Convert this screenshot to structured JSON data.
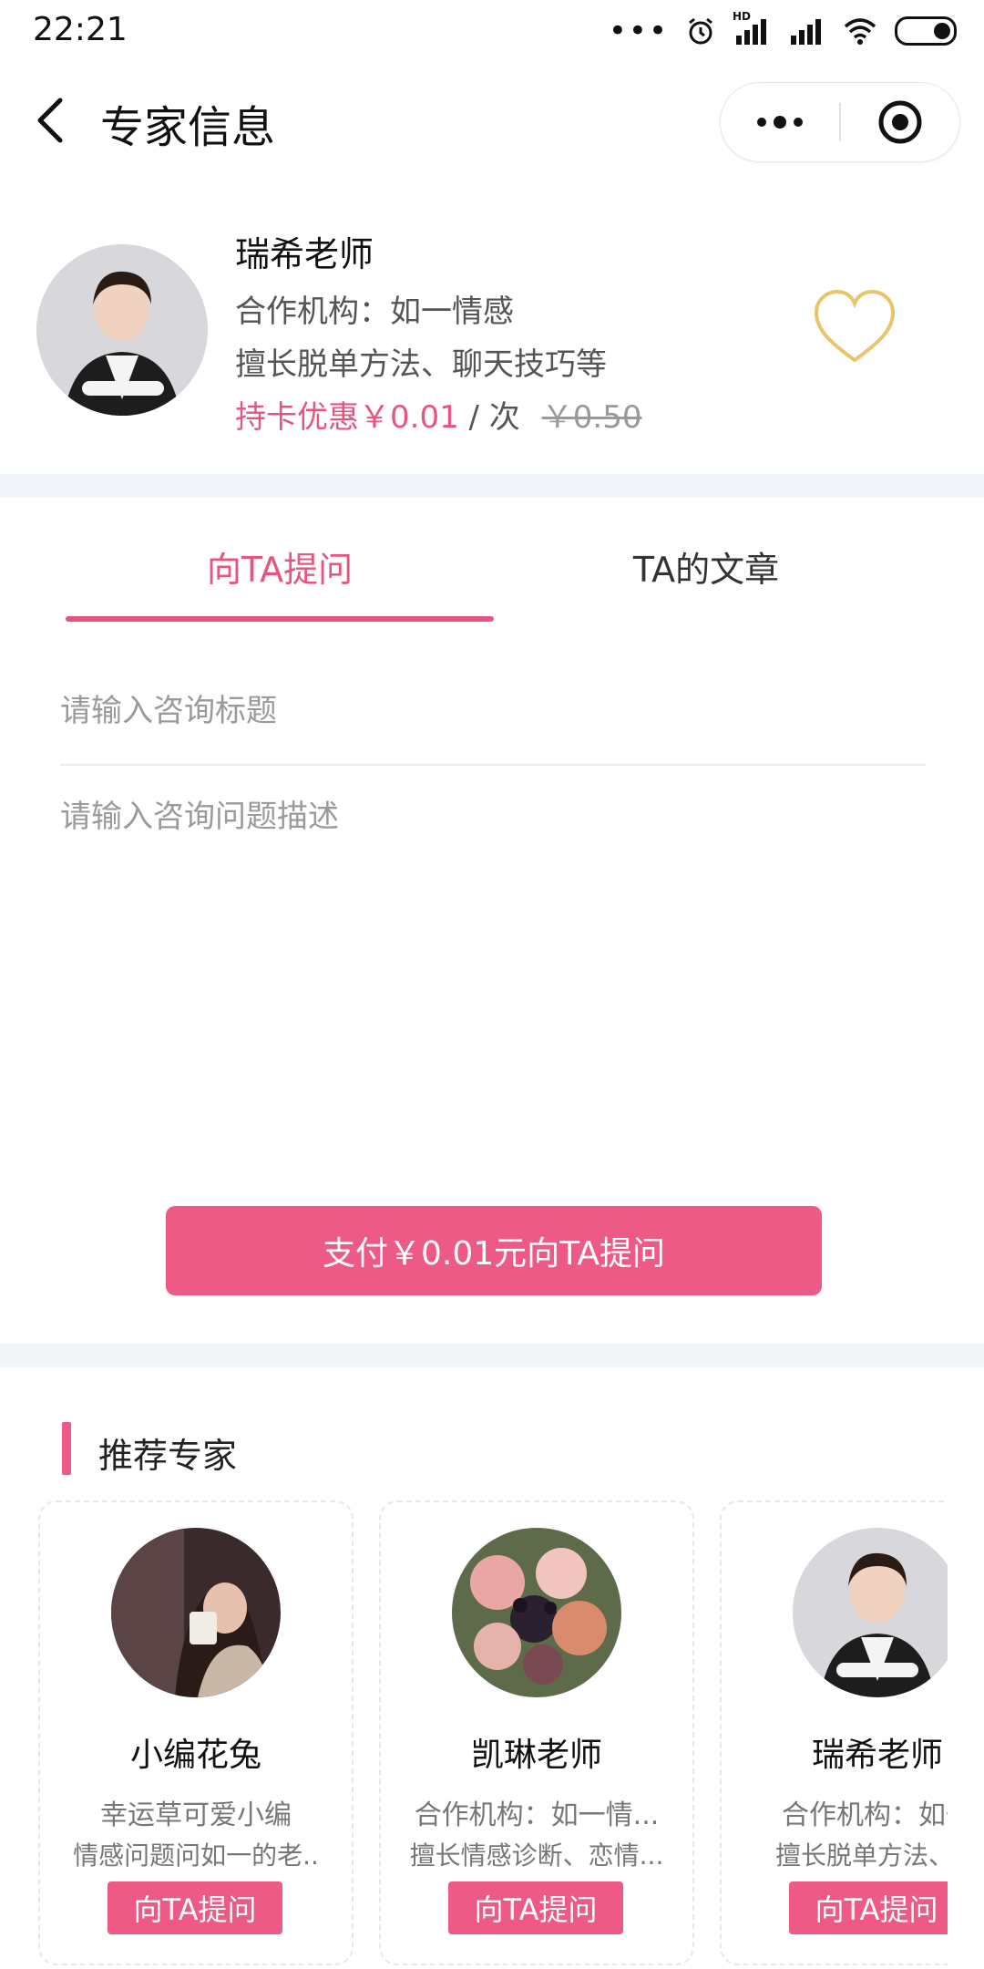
{
  "status_bar": {
    "time": "22:21",
    "hd_label": "HD"
  },
  "nav": {
    "title": "专家信息"
  },
  "expert": {
    "name": "瑞希老师",
    "org": "合作机构：如一情感",
    "skills": "擅长脱单方法、聊天技巧等",
    "price_label": "持卡优惠￥0.01",
    "price_unit": " / 次",
    "original_price": "￥0.50"
  },
  "tabs": [
    {
      "label": "向TA提问",
      "active": true
    },
    {
      "label": "TA的文章",
      "active": false
    }
  ],
  "form": {
    "title_placeholder": "请输入咨询标题",
    "desc_placeholder": "请输入咨询问题描述",
    "pay_button": "支付￥0.01元向TA提问"
  },
  "recommended": {
    "heading": "推荐专家",
    "experts": [
      {
        "name": "小编花兔",
        "line1": "幸运草可爱小编",
        "line2": "情感问题问如一的老..",
        "button": "向TA提问"
      },
      {
        "name": "凯琳老师",
        "line1": "合作机构：如一情...",
        "line2": "擅长情感诊断、恋情...",
        "button": "向TA提问"
      },
      {
        "name": "瑞希老师",
        "line1": "合作机构：如一",
        "line2": "擅长脱单方法、聊",
        "button": "向TA提问"
      }
    ]
  },
  "colors": {
    "accent": "#ec5a85",
    "heart": "#e9c46a",
    "band": "#f1f4f8"
  }
}
